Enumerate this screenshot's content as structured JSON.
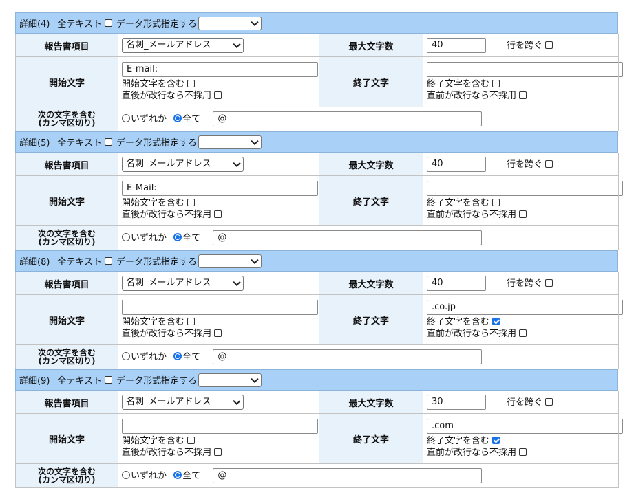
{
  "labels": {
    "section_prefix": "詳細",
    "all_text": "全テキスト",
    "data_format": "データ形式指定する",
    "report_item": "報告書項目",
    "max_chars": "最大文字数",
    "cross_rows": "行を跨ぐ",
    "start_text": "開始文字",
    "end_text": "終了文字",
    "include_start": "開始文字を含む",
    "exclude_after_newline": "直後が改行なら不採用",
    "include_end": "終了文字を含む",
    "exclude_before_newline": "直前が改行なら不採用",
    "contains_line1": "次の文字を含む",
    "contains_line2": "(カンマ区切り)",
    "radio_any": "いずれか",
    "radio_all": "全て"
  },
  "sections": [
    {
      "title": "詳細(4)",
      "all_text_checked": false,
      "data_format_value": "",
      "report_item": "名刺_メールアドレス",
      "max_chars": "40",
      "cross_rows_checked": false,
      "start_text": "E-mail:",
      "include_start_checked": false,
      "exclude_after_checked": false,
      "end_text": "",
      "include_end_checked": false,
      "exclude_before_checked": false,
      "match_mode": "all",
      "contains": "@"
    },
    {
      "title": "詳細(5)",
      "all_text_checked": false,
      "data_format_value": "",
      "report_item": "名刺_メールアドレス",
      "max_chars": "40",
      "cross_rows_checked": false,
      "start_text": "E-Mail:",
      "include_start_checked": false,
      "exclude_after_checked": false,
      "end_text": "",
      "include_end_checked": false,
      "exclude_before_checked": false,
      "match_mode": "all",
      "contains": "@"
    },
    {
      "title": "詳細(8)",
      "all_text_checked": false,
      "data_format_value": "",
      "report_item": "名刺_メールアドレス",
      "max_chars": "40",
      "cross_rows_checked": false,
      "start_text": "",
      "include_start_checked": false,
      "exclude_after_checked": false,
      "end_text": ".co.jp",
      "include_end_checked": true,
      "exclude_before_checked": false,
      "match_mode": "all",
      "contains": "@"
    },
    {
      "title": "詳細(9)",
      "all_text_checked": false,
      "data_format_value": "",
      "report_item": "名刺_メールアドレス",
      "max_chars": "30",
      "cross_rows_checked": false,
      "start_text": "",
      "include_start_checked": false,
      "exclude_after_checked": false,
      "end_text": ".com",
      "include_end_checked": true,
      "exclude_before_checked": false,
      "match_mode": "all",
      "contains": "@"
    }
  ]
}
